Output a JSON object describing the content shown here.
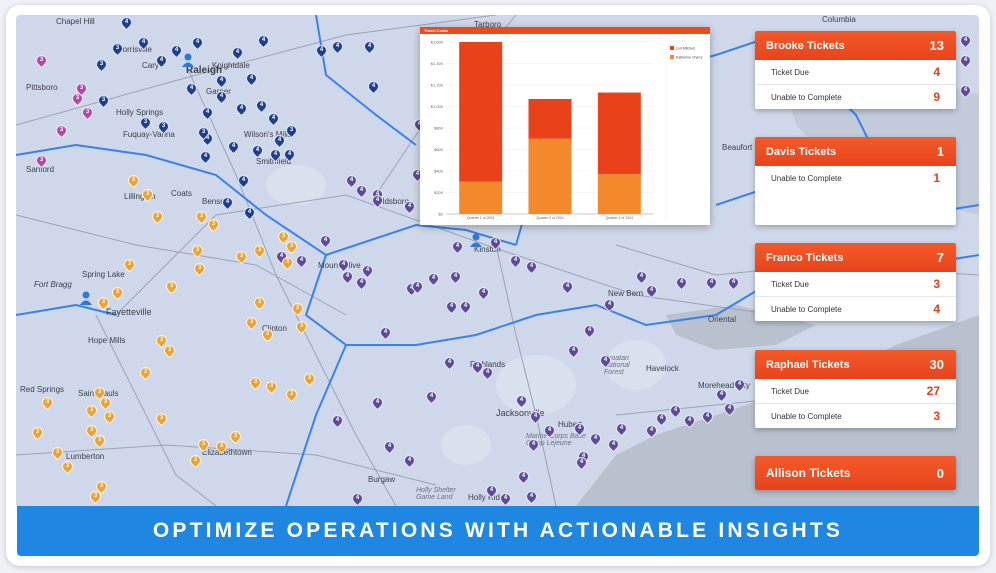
{
  "banner": {
    "text": "OPTIMIZE OPERATIONS WITH ACTIONABLE INSIGHTS"
  },
  "colors": {
    "accent": "#ef4a1c",
    "banner": "#1f86e2",
    "map_background": "#cfd8ea",
    "pin_navy": "#1c3f8f",
    "pin_purple": "#5d4a9b",
    "pin_orange": "#f0a22e",
    "pin_magenta": "#b04aa6",
    "territory_line": "#3a82e8"
  },
  "map": {
    "cities": [
      "Chapel Hill",
      "Morrisville",
      "Cary",
      "Raleigh",
      "Knightdale",
      "Garner",
      "Pittsboro",
      "Holly Springs",
      "Fuquay-Varina",
      "Wilson's Mills",
      "Smithfield",
      "Sanford",
      "Coats",
      "Lillington",
      "Benson",
      "Goldsboro",
      "Kinston",
      "Mount Olive",
      "Spring Lake",
      "Fort Bragg",
      "Fayetteville",
      "Hope Mills",
      "Clinton",
      "Red Springs",
      "Saint Pauls",
      "Lumberton",
      "Elizabethtown",
      "Richlands",
      "Jacksonville",
      "Hubert",
      "New Bern",
      "Havelock",
      "Oriental",
      "Morehead City",
      "Burgaw",
      "Holly Ridge",
      "Tarboro",
      "Columbia",
      "Beaufort"
    ],
    "map_labels": [
      "Croatan National Forest",
      "Marine Corps Base Camp Lejeune",
      "Holly Shelter Game Land"
    ]
  },
  "chart_card": {
    "title": "Travel Costs",
    "legend": [
      "Lori Mitchell",
      "Katherine Cherry"
    ]
  },
  "chart_data": {
    "type": "bar",
    "stacked": true,
    "categories": [
      "Quarter 1 of 2024",
      "Quarter 3 of 2024",
      "Quarter 4 of 2024"
    ],
    "series": [
      {
        "name": "Katherine Cherry",
        "values": [
          300,
          700,
          370
        ]
      },
      {
        "name": "Lori Mitchell",
        "values": [
          1300,
          370,
          760
        ]
      }
    ],
    "y_ticks": [
      "$0",
      "$200",
      "$400",
      "$600",
      "$800",
      "$1,000",
      "$1,200",
      "$1,400",
      "$1,600"
    ],
    "ylim": [
      0,
      1600
    ]
  },
  "tickets": [
    {
      "name": "Brooke Tickets",
      "total": "13",
      "rows": [
        {
          "label": "Ticket Due",
          "value": "4"
        },
        {
          "label": "Unable to Complete",
          "value": "9"
        }
      ]
    },
    {
      "name": "Davis Tickets",
      "total": "1",
      "rows": [
        {
          "label": "Unable to Complete",
          "value": "1"
        }
      ]
    },
    {
      "name": "Franco Tickets",
      "total": "7",
      "rows": [
        {
          "label": "Ticket Due",
          "value": "3"
        },
        {
          "label": "Unable to Complete",
          "value": "4"
        }
      ]
    },
    {
      "name": "Raphael Tickets",
      "total": "30",
      "rows": [
        {
          "label": "Ticket Due",
          "value": "27"
        },
        {
          "label": "Unable to Complete",
          "value": "3"
        }
      ]
    },
    {
      "name": "Allison Tickets",
      "total": "0",
      "rows": []
    }
  ]
}
